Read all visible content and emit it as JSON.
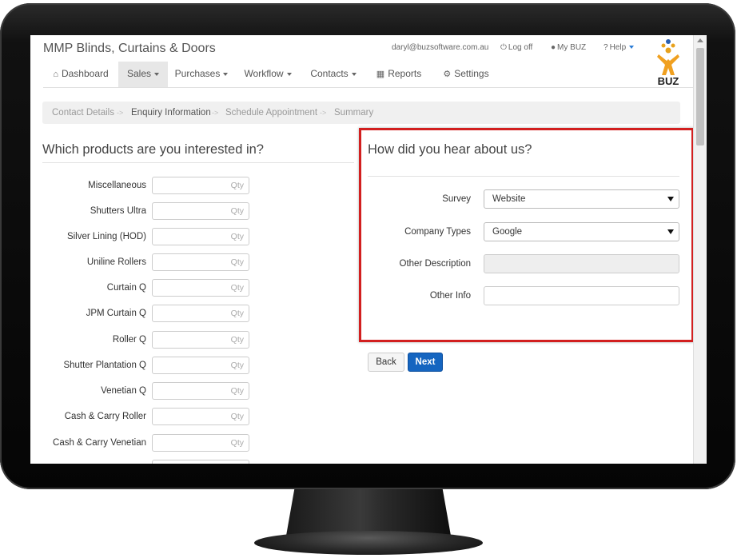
{
  "app": {
    "title": "MMP Blinds, Curtains & Doors",
    "user_email": "daryl@buzsoftware.com.au",
    "logout_label": "Log off",
    "mybuz_label": "My BUZ",
    "help_label": "Help",
    "logo_text": "BUZ"
  },
  "nav": {
    "items": [
      {
        "label": "Dashboard",
        "icon": "home-icon"
      },
      {
        "label": "Sales",
        "active": true
      },
      {
        "label": "Purchases"
      },
      {
        "label": "Workflow"
      },
      {
        "label": "Contacts"
      },
      {
        "label": "Reports",
        "icon": "chart-icon"
      },
      {
        "label": "Settings",
        "icon": "gears-icon"
      }
    ]
  },
  "breadcrumb": {
    "steps": [
      "Contact Details",
      "Enquiry Information",
      "Schedule Appointment",
      "Summary"
    ],
    "separator": "->",
    "current_index": 1
  },
  "products": {
    "heading": "Which products are you interested in?",
    "qty_placeholder": "Qty",
    "items": [
      "Miscellaneous",
      "Shutters Ultra",
      "Silver Lining (HOD)",
      "Uniline Rollers",
      "Curtain Q",
      "JPM Curtain Q",
      "Roller Q",
      "Shutter Plantation Q",
      "Venetian Q",
      "Cash & Carry Roller",
      "Cash & Carry Venetian"
    ]
  },
  "hear_about": {
    "heading": "How did you hear about us?",
    "survey": {
      "label": "Survey",
      "value": "Website"
    },
    "company_types": {
      "label": "Company Types",
      "value": "Google"
    },
    "other_description": {
      "label": "Other Description",
      "value": ""
    },
    "other_info": {
      "label": "Other Info",
      "value": ""
    }
  },
  "buttons": {
    "back": "Back",
    "next": "Next"
  },
  "colors": {
    "highlight_border": "#d21f1f",
    "primary_button": "#1565c0"
  }
}
